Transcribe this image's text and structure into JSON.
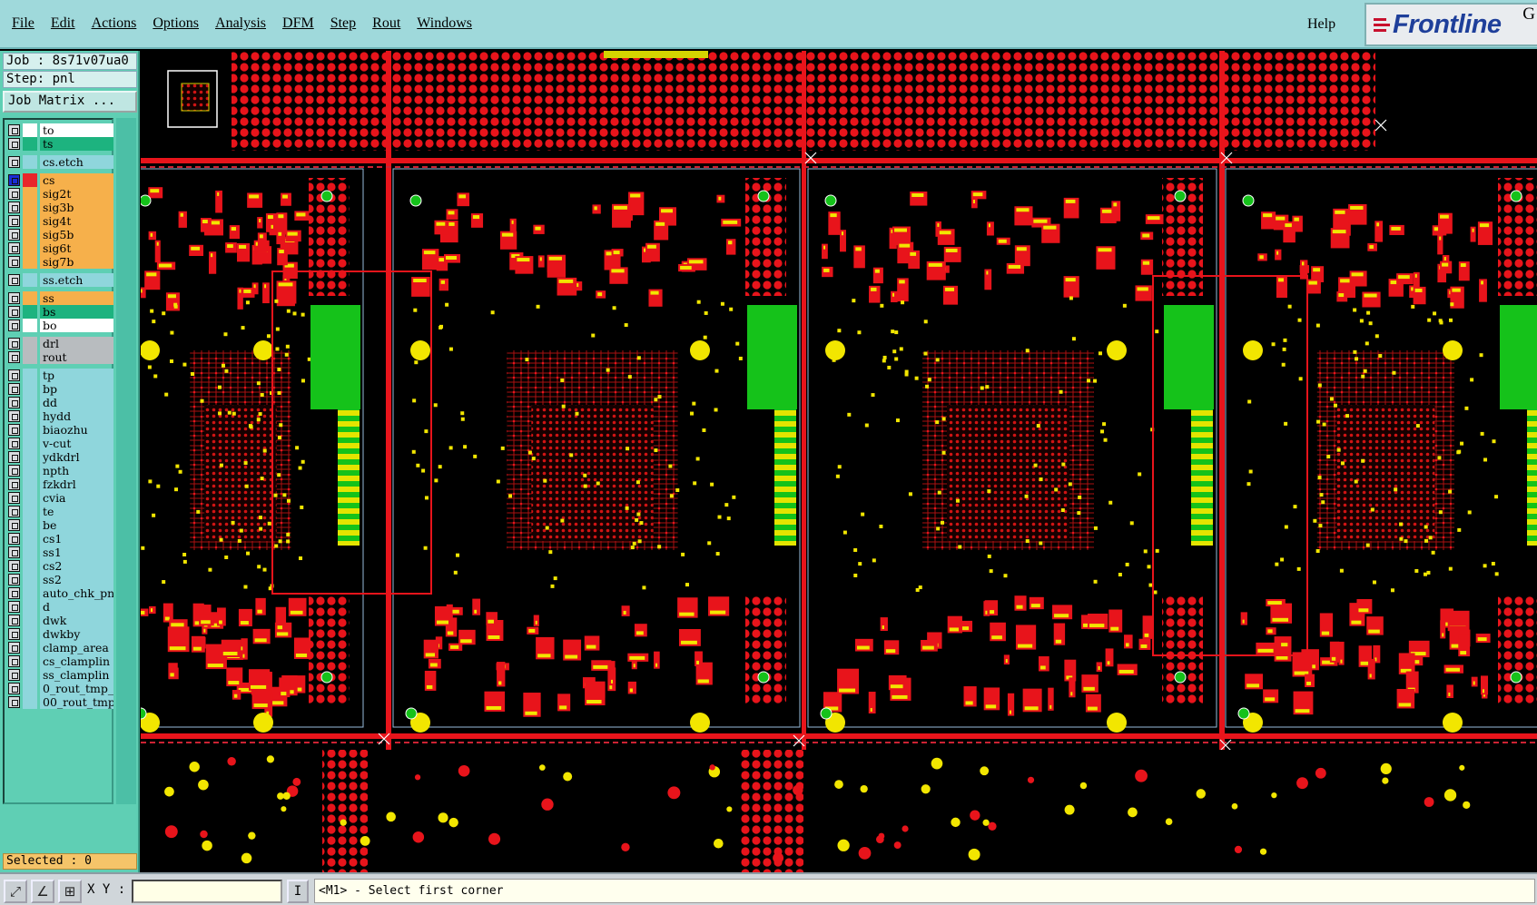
{
  "menubar": {
    "items": [
      "File",
      "Edit",
      "Actions",
      "Options",
      "Analysis",
      "DFM",
      "Step",
      "Rout",
      "Windows"
    ],
    "help": "Help",
    "logo_text": "Frontline",
    "logo_suffix": "G"
  },
  "job": {
    "job_line": "Job : 8s71v07ua0",
    "step_line": "Step: pnl",
    "matrix_button": "Job Matrix ..."
  },
  "layers": [
    {
      "name": "to",
      "bg": "#ffffff",
      "swatch": "#ffffff"
    },
    {
      "name": "ts",
      "bg": "#1db37f",
      "swatch": "#1db37f"
    },
    {
      "name": "cs.etch",
      "bg": "#8fd6dc",
      "swatch": "#8fd6dc"
    },
    {
      "name": "cs",
      "bg": "#f6b04b",
      "swatch": "#e8262b",
      "active": true
    },
    {
      "name": "sig2t",
      "bg": "#f6b04b",
      "swatch": "#f6b04b"
    },
    {
      "name": "sig3b",
      "bg": "#f6b04b",
      "swatch": "#f6b04b"
    },
    {
      "name": "sig4t",
      "bg": "#f6b04b",
      "swatch": "#f6b04b"
    },
    {
      "name": "sig5b",
      "bg": "#f6b04b",
      "swatch": "#f6b04b"
    },
    {
      "name": "sig6t",
      "bg": "#f6b04b",
      "swatch": "#f6b04b"
    },
    {
      "name": "sig7b",
      "bg": "#f6b04b",
      "swatch": "#f6b04b"
    },
    {
      "name": "ss.etch",
      "bg": "#8fd6dc",
      "swatch": "#8fd6dc"
    },
    {
      "name": "ss",
      "bg": "#f6b04b",
      "swatch": "#f6b04b"
    },
    {
      "name": "bs",
      "bg": "#1db37f",
      "swatch": "#1db37f"
    },
    {
      "name": "bo",
      "bg": "#ffffff",
      "swatch": "#ffffff"
    },
    {
      "name": "drl",
      "bg": "#b8bcbf",
      "swatch": "#b8bcbf"
    },
    {
      "name": "rout",
      "bg": "#b8bcbf",
      "swatch": "#b8bcbf"
    },
    {
      "name": "tp",
      "bg": "#8fd6dc",
      "swatch": "#8fd6dc"
    },
    {
      "name": "bp",
      "bg": "#8fd6dc",
      "swatch": "#8fd6dc"
    },
    {
      "name": "dd",
      "bg": "#8fd6dc",
      "swatch": "#8fd6dc"
    },
    {
      "name": "hydd",
      "bg": "#8fd6dc",
      "swatch": "#8fd6dc"
    },
    {
      "name": "biaozhu",
      "bg": "#8fd6dc",
      "swatch": "#8fd6dc"
    },
    {
      "name": "v-cut",
      "bg": "#8fd6dc",
      "swatch": "#8fd6dc"
    },
    {
      "name": "ydkdrl",
      "bg": "#8fd6dc",
      "swatch": "#8fd6dc"
    },
    {
      "name": "npth",
      "bg": "#8fd6dc",
      "swatch": "#8fd6dc"
    },
    {
      "name": "fzkdrl",
      "bg": "#8fd6dc",
      "swatch": "#8fd6dc"
    },
    {
      "name": "cvia",
      "bg": "#8fd6dc",
      "swatch": "#8fd6dc"
    },
    {
      "name": "te",
      "bg": "#8fd6dc",
      "swatch": "#8fd6dc"
    },
    {
      "name": "be",
      "bg": "#8fd6dc",
      "swatch": "#8fd6dc"
    },
    {
      "name": "cs1",
      "bg": "#8fd6dc",
      "swatch": "#8fd6dc"
    },
    {
      "name": "ss1",
      "bg": "#8fd6dc",
      "swatch": "#8fd6dc"
    },
    {
      "name": "cs2",
      "bg": "#8fd6dc",
      "swatch": "#8fd6dc"
    },
    {
      "name": "ss2",
      "bg": "#8fd6dc",
      "swatch": "#8fd6dc"
    },
    {
      "name": "auto_chk_pn",
      "bg": "#8fd6dc",
      "swatch": "#8fd6dc"
    },
    {
      "name": "d",
      "bg": "#8fd6dc",
      "swatch": "#8fd6dc"
    },
    {
      "name": "dwk",
      "bg": "#8fd6dc",
      "swatch": "#8fd6dc"
    },
    {
      "name": "dwkby",
      "bg": "#8fd6dc",
      "swatch": "#8fd6dc"
    },
    {
      "name": "clamp_area",
      "bg": "#8fd6dc",
      "swatch": "#8fd6dc"
    },
    {
      "name": "cs_clamplin",
      "bg": "#8fd6dc",
      "swatch": "#8fd6dc"
    },
    {
      "name": "ss_clamplin",
      "bg": "#8fd6dc",
      "swatch": "#8fd6dc"
    },
    {
      "name": "0_rout_tmp_",
      "bg": "#8fd6dc",
      "swatch": "#8fd6dc"
    },
    {
      "name": "00_rout_tmp",
      "bg": "#8fd6dc",
      "swatch": "#8fd6dc"
    }
  ],
  "selected": "Selected : 0",
  "statusbar": {
    "xy_label": "X Y :",
    "xy_value": "",
    "xy_toggle": "I",
    "prompt": "<M1> - Select first corner"
  },
  "colors": {
    "board_red": "#e8141b",
    "pad_yellow": "#f2e600",
    "fiducial_green": "#15c21a",
    "background": "#000000"
  }
}
